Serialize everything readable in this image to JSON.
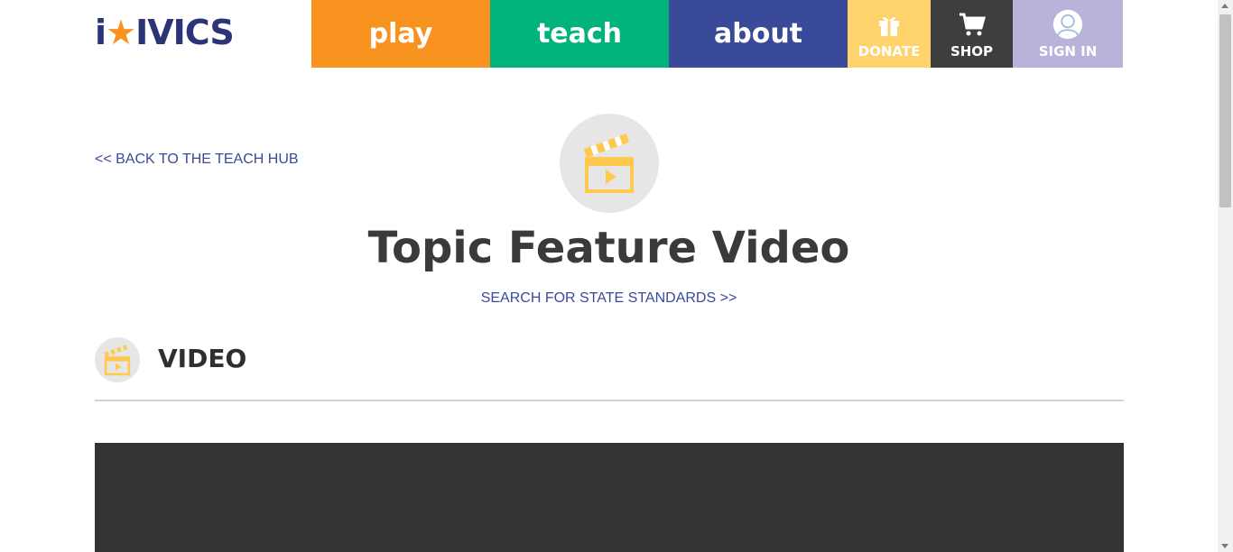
{
  "header": {
    "logo": {
      "prefix": "i",
      "star": "★",
      "suffix": "IVICS"
    },
    "nav": {
      "play": "play",
      "teach": "teach",
      "about": "about",
      "donate": "DONATE",
      "shop": "SHOP",
      "signin": "SIGN IN"
    },
    "colors": {
      "play": "#f7931e",
      "teach": "#00b37a",
      "about": "#3a4a9a",
      "donate": "#ffd36b",
      "shop": "#3e3e3e",
      "signin": "#b9b3dc"
    }
  },
  "page": {
    "back_link": "<< BACK TO THE TEACH HUB",
    "title": "Topic Feature Video",
    "search_standards": "SEARCH FOR STATE STANDARDS >>",
    "hero_icon": "clapperboard-icon"
  },
  "section": {
    "title": "VIDEO",
    "icon": "clapperboard-icon"
  }
}
